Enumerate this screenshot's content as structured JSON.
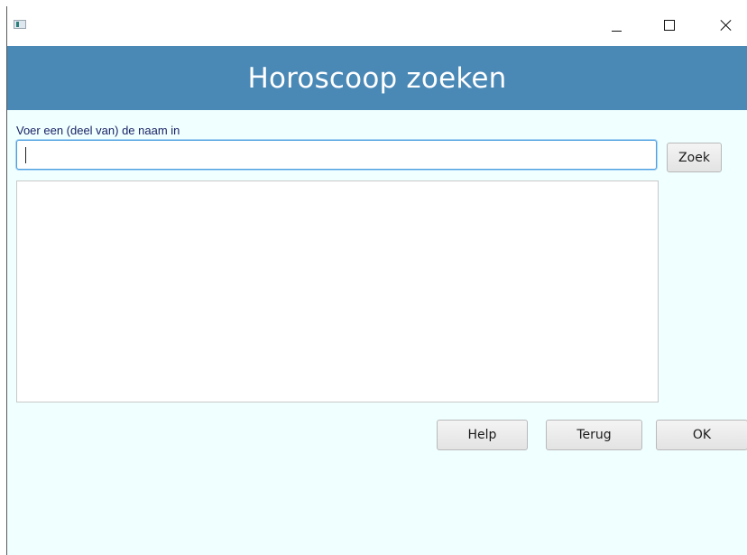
{
  "window": {
    "controls": {
      "minimize_icon": "minimize-icon",
      "maximize_icon": "maximize-icon",
      "close_icon": "close-icon"
    }
  },
  "header": {
    "title": "Horoscoop zoeken",
    "background": "#4a88b6"
  },
  "search": {
    "prompt": "Voer een (deel van) de naam in",
    "value": "",
    "button_label": "Zoek"
  },
  "results": {
    "items": []
  },
  "footer": {
    "help_label": "Help",
    "back_label": "Terug",
    "ok_label": "OK"
  },
  "colors": {
    "window_background": "#f0ffff",
    "label_text": "#1a2366",
    "focus_border": "#4a9fe0"
  }
}
